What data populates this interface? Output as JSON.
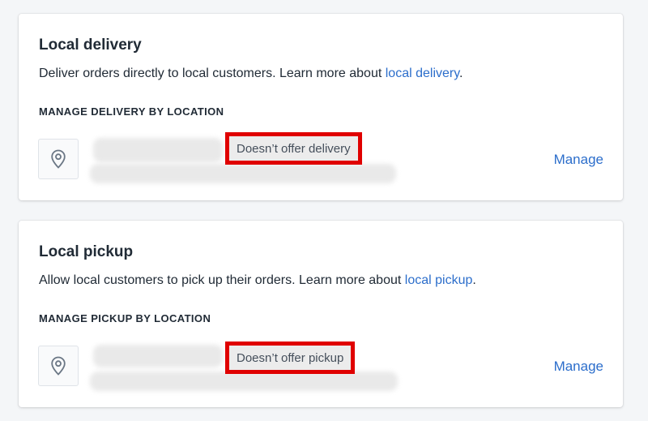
{
  "local_delivery": {
    "title": "Local delivery",
    "description_prefix": "Deliver orders directly to local customers. Learn more about ",
    "description_link": "local delivery",
    "description_suffix": ".",
    "section_heading": "MANAGE DELIVERY BY LOCATION",
    "location_icon": "map-pin-icon",
    "status_badge": "Doesn’t offer delivery",
    "manage_label": "Manage"
  },
  "local_pickup": {
    "title": "Local pickup",
    "description_prefix": "Allow local customers to pick up their orders. Learn more about ",
    "description_link": "local pickup",
    "description_suffix": ".",
    "section_heading": "MANAGE PICKUP BY LOCATION",
    "location_icon": "map-pin-icon",
    "status_badge": "Doesn’t offer pickup",
    "manage_label": "Manage"
  },
  "colors": {
    "link": "#2c6ecb",
    "highlight_border": "#e00000",
    "background": "#f4f6f8"
  }
}
